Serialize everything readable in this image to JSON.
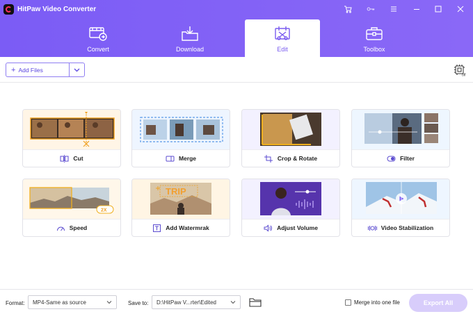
{
  "app": {
    "title": "HitPaw Video Converter"
  },
  "colors": {
    "accent": "#7b5cf5",
    "export_disabled": "#d8cdfb"
  },
  "tabs": [
    {
      "label": "Convert",
      "icon": "convert-icon",
      "active": false
    },
    {
      "label": "Download",
      "icon": "download-icon",
      "active": false
    },
    {
      "label": "Edit",
      "icon": "edit-icon",
      "active": true
    },
    {
      "label": "Toolbox",
      "icon": "toolbox-icon",
      "active": false
    }
  ],
  "toolbar": {
    "add_files_label": "Add Files"
  },
  "tools": [
    {
      "label": "Cut",
      "icon": "cut-icon"
    },
    {
      "label": "Merge",
      "icon": "merge-icon"
    },
    {
      "label": "Crop & Rotate",
      "icon": "crop-icon"
    },
    {
      "label": "Filter",
      "icon": "filter-icon"
    },
    {
      "label": "Speed",
      "icon": "speed-icon"
    },
    {
      "label": "Add Watermrak",
      "icon": "watermark-icon"
    },
    {
      "label": "Adjust Volume",
      "icon": "volume-icon"
    },
    {
      "label": "Video Stabilization",
      "icon": "stabilization-icon"
    }
  ],
  "speed_badge": "2X",
  "watermark_text": "TRIP",
  "bottom": {
    "format_label": "Format:",
    "format_value": "MP4-Same as source",
    "save_to_label": "Save to:",
    "save_to_value": "D:\\HitPaw V...rter\\Edited",
    "merge_label": "Merge into one file",
    "export_label": "Export All"
  }
}
